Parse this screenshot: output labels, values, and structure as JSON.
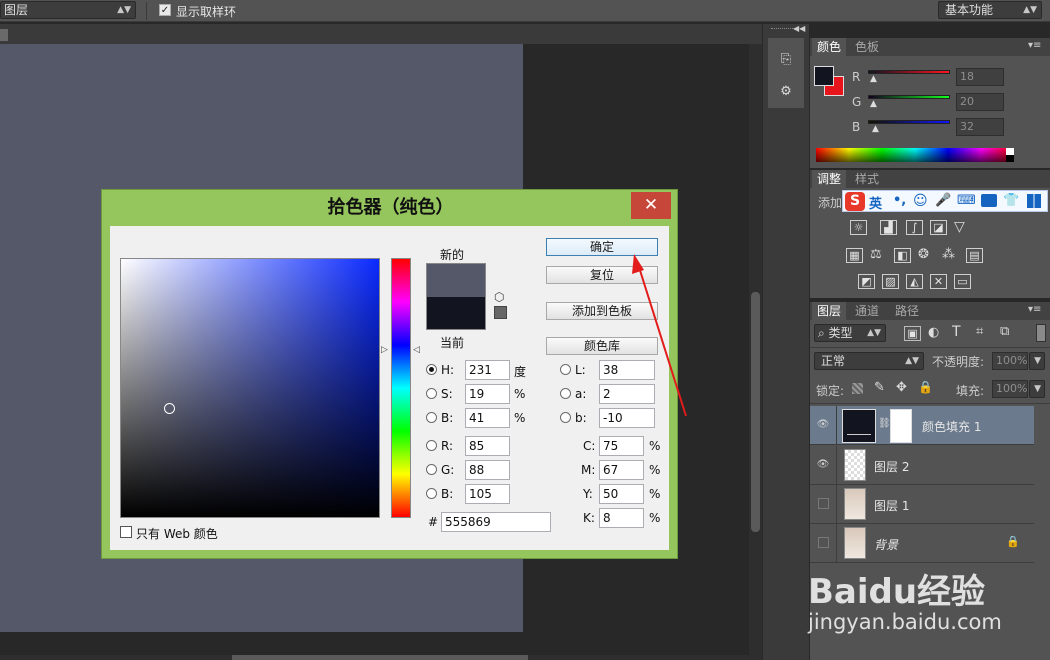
{
  "options_bar": {
    "sample_select": "图层",
    "show_ring_checked": "✓",
    "show_ring_label": "显示取样环",
    "workspace_select": "基本功能"
  },
  "color_panel": {
    "tabs": [
      "颜色",
      "色板"
    ],
    "rows": [
      {
        "label": "R",
        "value": "18"
      },
      {
        "label": "G",
        "value": "20"
      },
      {
        "label": "B",
        "value": "32"
      }
    ],
    "foreground_color": "#121420",
    "background_color": "#e8141c"
  },
  "adjust_panel": {
    "tabs": [
      "调整",
      "样式"
    ],
    "add_label": "添加",
    "ime_label": "英"
  },
  "layers_panel": {
    "tabs": [
      "图层",
      "通道",
      "路径"
    ],
    "kind_filter": "类型",
    "blend_mode": "正常",
    "opacity_label": "不透明度:",
    "opacity_value": "100%",
    "lock_label": "锁定:",
    "fill_label": "填充:",
    "fill_value": "100%",
    "layers": [
      {
        "name": "颜色填充 1",
        "visible": true,
        "selected": true
      },
      {
        "name": "图层 2",
        "visible": true,
        "selected": false
      },
      {
        "name": "图层 1",
        "visible": false,
        "selected": false
      },
      {
        "name": "背景",
        "visible": false,
        "selected": false
      }
    ]
  },
  "color_picker": {
    "title": "拾色器（纯色）",
    "close_glyph": "✕",
    "new_label": "新的",
    "current_label": "当前",
    "new_color": "#555869",
    "current_color": "#121420",
    "buttons": {
      "ok": "确定",
      "reset": "复位",
      "add_swatch": "添加到色板",
      "libraries": "颜色库"
    },
    "hsb": [
      {
        "label": "H:",
        "value": "231",
        "unit": "度",
        "selected": true
      },
      {
        "label": "S:",
        "value": "19",
        "unit": "%",
        "selected": false
      },
      {
        "label": "B:",
        "value": "41",
        "unit": "%",
        "selected": false
      }
    ],
    "rgb": [
      {
        "label": "R:",
        "value": "85"
      },
      {
        "label": "G:",
        "value": "88"
      },
      {
        "label": "B:",
        "value": "105"
      }
    ],
    "lab": [
      {
        "label": "L:",
        "value": "38"
      },
      {
        "label": "a:",
        "value": "2"
      },
      {
        "label": "b:",
        "value": "-10"
      }
    ],
    "cmyk": [
      {
        "label": "C:",
        "value": "75",
        "unit": "%"
      },
      {
        "label": "M:",
        "value": "67",
        "unit": "%"
      },
      {
        "label": "Y:",
        "value": "50",
        "unit": "%"
      },
      {
        "label": "K:",
        "value": "8",
        "unit": "%"
      }
    ],
    "hex_label": "#",
    "hex_value": "555869",
    "web_only_label": "只有 Web 颜色"
  },
  "watermark": {
    "brand": "Baidu经验",
    "url": "jingyan.baidu.com"
  }
}
